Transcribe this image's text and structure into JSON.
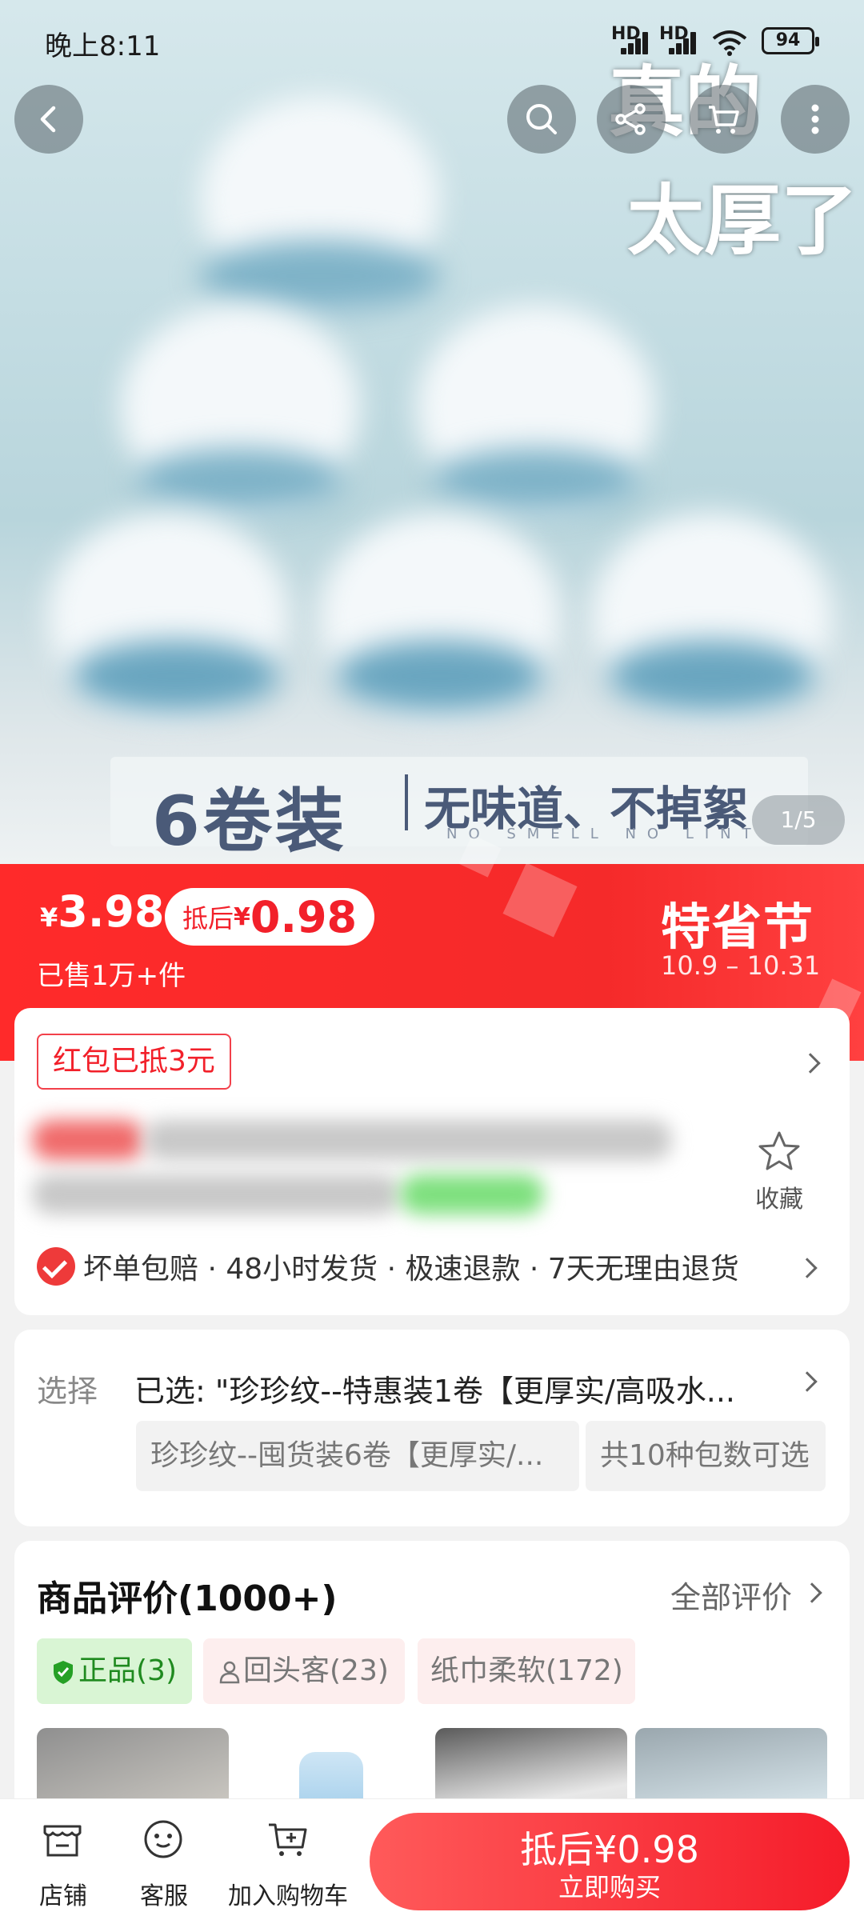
{
  "status_bar": {
    "time": "晚上8:11",
    "sig1": "HD",
    "sig2": "HD",
    "battery": "94"
  },
  "gallery": {
    "overlay_line1": "真的",
    "overlay_line2": "太厚了",
    "banner_big": "6卷装",
    "banner_small": "无味道、不掉絮",
    "banner_sub": "NO SMELL NO LINT",
    "pager": "1/5"
  },
  "price": {
    "currency": "¥",
    "amount": "3.98",
    "after_label": "抵后",
    "after_currency": "¥",
    "after_amount": "0.98",
    "sold": "已售1万+件",
    "festival": "特省节",
    "festival_dates": "10.9 – 10.31"
  },
  "info": {
    "red_packet": "红包已抵3元",
    "favorite_label": "收藏",
    "guarantee": "坏单包赔 · 48小时发货 · 极速退款 · 7天无理由退货"
  },
  "selection": {
    "label": "选择",
    "selected": "已选:  \"珍珍纹--特惠装1卷【更厚实/高吸水...",
    "option1": "珍珍纹--囤货装6卷【更厚实/...",
    "option2": "共10种包数可选"
  },
  "reviews": {
    "title": "商品评价(1000+)",
    "all": "全部评价",
    "tags": [
      "正品(3)",
      "回头客(23)",
      "纸巾柔软(172)"
    ]
  },
  "bottom": {
    "shop": "店铺",
    "service": "客服",
    "cart": "加入购物车",
    "buy_top": "抵后¥0.98",
    "buy_bottom": "立即购买"
  },
  "colors": {
    "accent": "#f52a2a",
    "tag_green_bg": "#d9f5d4",
    "tag_pink_bg": "#fdeeee"
  }
}
